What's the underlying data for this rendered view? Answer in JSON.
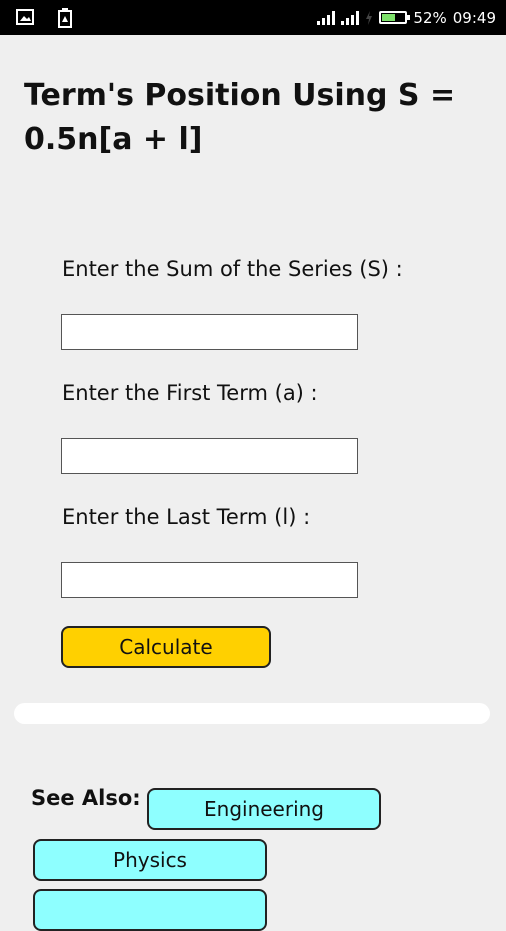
{
  "status_bar": {
    "battery_percent": "52%",
    "time": "09:49",
    "icons": [
      "image-notification-icon",
      "download-notification-icon",
      "signal-icon",
      "signal-icon",
      "charging-icon",
      "battery-icon"
    ]
  },
  "page": {
    "title": "Term's Position Using S = 0.5n[a + l]"
  },
  "form": {
    "sum_label": "Enter the Sum of the Series (S) :",
    "sum_value": "",
    "first_label": "Enter the First Term (a) :",
    "first_value": "",
    "last_label": "Enter the Last Term (l) :",
    "last_value": "",
    "calculate_label": "Calculate"
  },
  "result": {
    "text": ""
  },
  "see_also": {
    "label": "See Also:",
    "links": [
      "Engineering",
      "Physics",
      ""
    ]
  },
  "colors": {
    "background": "#efefef",
    "calculate_button": "#ffd000",
    "link_button": "#8effff",
    "status_bar": "#000000"
  }
}
